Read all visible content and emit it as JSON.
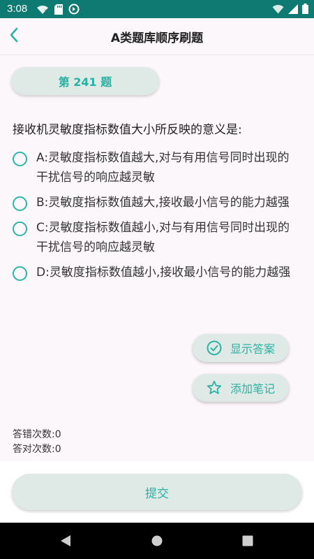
{
  "status_bar": {
    "time": "3:08",
    "icons_left": [
      "wifi-question-icon",
      "sd-card-icon",
      "no-sync-icon"
    ],
    "icons_right": [
      "wifi-icon",
      "signal-icon",
      "battery-icon"
    ]
  },
  "app_bar": {
    "back_icon": "chevron-left-icon",
    "title": "A类题库顺序刷题"
  },
  "question": {
    "number_label": "第 241 题",
    "text": "接收机灵敏度指标数值大小所反映的意义是:",
    "options": [
      {
        "label": "A:灵敏度指标数值越大,对与有用信号同时出现的干扰信号的响应越灵敏"
      },
      {
        "label": "B:灵敏度指标数值越大,接收最小信号的能力越强"
      },
      {
        "label": "C:灵敏度指标数值越小,对与有用信号同时出现的干扰信号的响应越灵敏"
      },
      {
        "label": "D:灵敏度指标数值越小,接收最小信号的能力越强"
      }
    ]
  },
  "actions": {
    "show_answer_label": "显示答案",
    "add_note_label": "添加笔记",
    "submit_label": "提交"
  },
  "stats": {
    "wrong_count_line": "答错次数:0",
    "right_count_line": "答对次数:0"
  },
  "colors": {
    "status_bar": "#0f7a72",
    "accent": "#29b2a3",
    "button_bg": "#dfe9e6",
    "page_bg": "#fcf7fb"
  },
  "nav_bar": {
    "icons": [
      "back-triangle-icon",
      "home-circle-icon",
      "recents-square-icon"
    ]
  }
}
